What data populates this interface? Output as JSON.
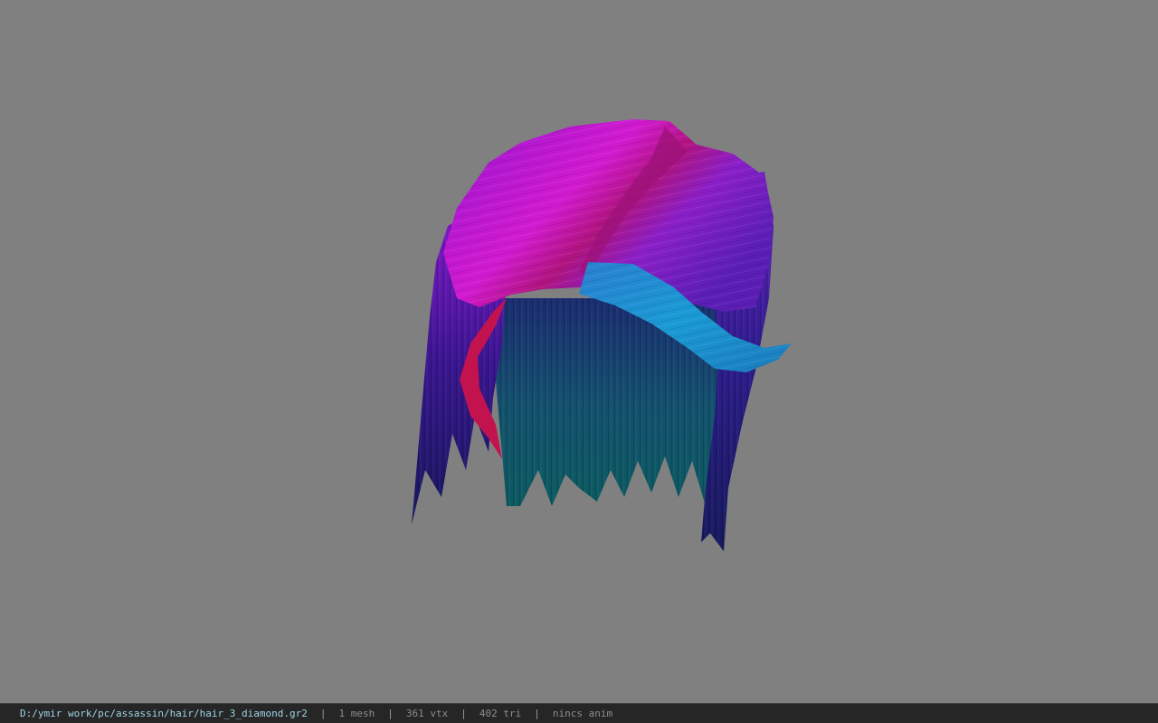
{
  "viewport": {
    "background": "#808080",
    "model": {
      "icon": "hair-mesh-model",
      "colors": {
        "crown_purple": "#a416d6",
        "crown_magenta": "#d51bc9",
        "strand_navy": "#1b1470",
        "strand_teal": "#0f4e6a",
        "band_cyan": "#1a8fd0",
        "accent_red": "#c8145a"
      }
    }
  },
  "status": {
    "path": "D:/ymir work/pc/assassin/hair/hair_3_diamond.gr2",
    "separator": "|",
    "mesh": "1 mesh",
    "vertices": "361 vtx",
    "triangles": "402 tri",
    "anim": "nincs anim"
  }
}
